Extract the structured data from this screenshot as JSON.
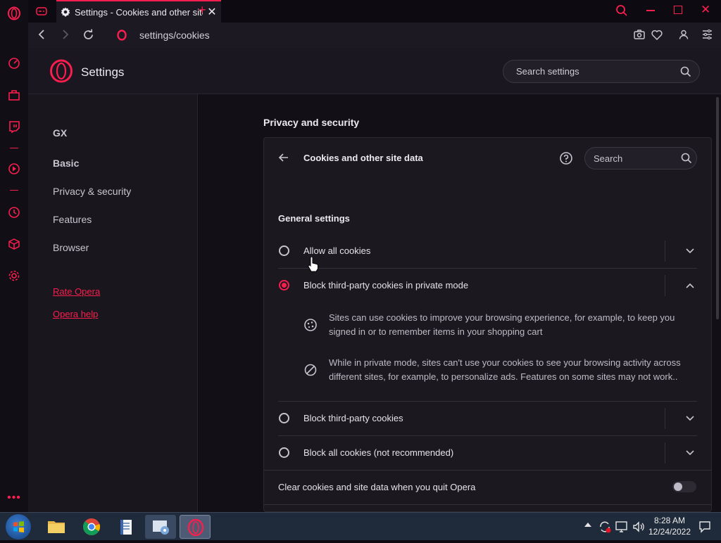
{
  "tab": {
    "title": "Settings - Cookies and other site data",
    "icon": "gear-icon"
  },
  "address": {
    "url": "settings/cookies"
  },
  "header": {
    "title": "Settings",
    "search_placeholder": "Search settings"
  },
  "sidebar": {
    "items": [
      {
        "label": "GX"
      },
      {
        "label": "Basic"
      },
      {
        "label": "Privacy & security"
      },
      {
        "label": "Features"
      },
      {
        "label": "Browser"
      }
    ],
    "links": [
      {
        "label": "Rate Opera"
      },
      {
        "label": "Opera help"
      }
    ]
  },
  "main": {
    "section_title": "Privacy and security",
    "panel": {
      "title": "Cookies and other site data",
      "search_placeholder": "Search",
      "general_settings": "General settings",
      "options": [
        {
          "label": "Allow all cookies",
          "selected": false
        },
        {
          "label": "Block third-party cookies in private mode",
          "selected": true
        },
        {
          "label": "Block third-party cookies",
          "selected": false
        },
        {
          "label": "Block all cookies (not recommended)",
          "selected": false
        }
      ],
      "details": [
        {
          "icon": "cookie-icon",
          "text": "Sites can use cookies to improve your browsing experience, for example, to keep you signed in or to remember items in your shopping cart"
        },
        {
          "icon": "block-icon",
          "text": "While in private mode, sites can't use your cookies to see your browsing activity across different sites, for example, to personalize ads. Features on some sites may not work.."
        }
      ],
      "clear_on_quit": {
        "label": "Clear cookies and site data when you quit Opera",
        "enabled": false
      }
    }
  },
  "taskbar": {
    "time": "8:28 AM",
    "date": "12/24/2022"
  },
  "colors": {
    "accent": "#fa1e4e",
    "background": "#121016",
    "card": "#1b1820"
  }
}
